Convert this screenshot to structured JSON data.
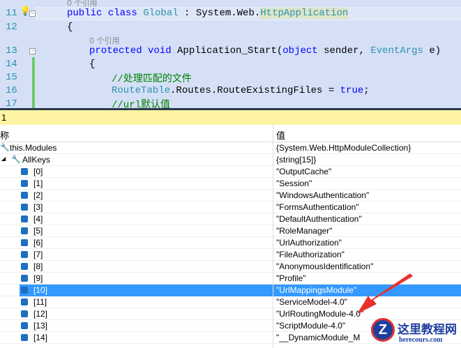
{
  "code": {
    "lines": [
      {
        "num": "11",
        "text": "public class Global : System.Web.HttpApplication"
      },
      {
        "num": "12",
        "text": "{"
      },
      {
        "num": "13",
        "text": "protected void Application_Start(object sender, EventArgs e)"
      },
      {
        "num": "14",
        "text": "{"
      },
      {
        "num": "15",
        "text": "//处理匹配的文件"
      },
      {
        "num": "16",
        "text": "RouteTable.Routes.RouteExistingFiles = true;"
      },
      {
        "num": "17",
        "text": "//url默认值"
      }
    ],
    "refs": [
      "0 个引用",
      "0 个引用"
    ],
    "l11": {
      "a": "public class ",
      "b": "Global",
      " c": "",
      "c2": " : System.Web.",
      "d": "HttpApplication"
    },
    "l13": {
      "a": "protected void ",
      "b": "Application_Start(",
      "c": "object",
      " d": " sender, ",
      "e": "EventArgs",
      "f": " e)"
    },
    "l16": {
      "a": "RouteTable",
      "b": ".Routes.RouteExistingFiles = ",
      "c": "true",
      ";": ";"
    }
  },
  "panel": {
    "title": "1",
    "col_name": "称",
    "col_value": "值"
  },
  "rows": [
    {
      "name": "this.Modules",
      "value": "{System.Web.HttpModuleCollection}"
    },
    {
      "name": "AllKeys",
      "value": "{string[15]}"
    },
    {
      "name": "[0]",
      "value": "\"OutputCache\""
    },
    {
      "name": "[1]",
      "value": "\"Session\""
    },
    {
      "name": "[2]",
      "value": "\"WindowsAuthentication\""
    },
    {
      "name": "[3]",
      "value": "\"FormsAuthentication\""
    },
    {
      "name": "[4]",
      "value": "\"DefaultAuthentication\""
    },
    {
      "name": "[5]",
      "value": "\"RoleManager\""
    },
    {
      "name": "[6]",
      "value": "\"UrlAuthorization\""
    },
    {
      "name": "[7]",
      "value": "\"FileAuthorization\""
    },
    {
      "name": "[8]",
      "value": "\"AnonymousIdentification\""
    },
    {
      "name": "[9]",
      "value": "\"Profile\""
    },
    {
      "name": "[10]",
      "value": "\"UrlMappingsModule\""
    },
    {
      "name": "[11]",
      "value": "\"ServiceModel-4.0\""
    },
    {
      "name": "[12]",
      "value": "\"UrlRoutingModule-4.0\""
    },
    {
      "name": "[13]",
      "value": "\"ScriptModule-4.0\""
    },
    {
      "name": "[14]",
      "value": "\"__DynamicModule_M"
    }
  ],
  "watermark": {
    "title": "这里教程网",
    "url": "herecours.com"
  },
  "colors": {
    "selected": "#3399ff",
    "arrow": "#e8302c"
  }
}
